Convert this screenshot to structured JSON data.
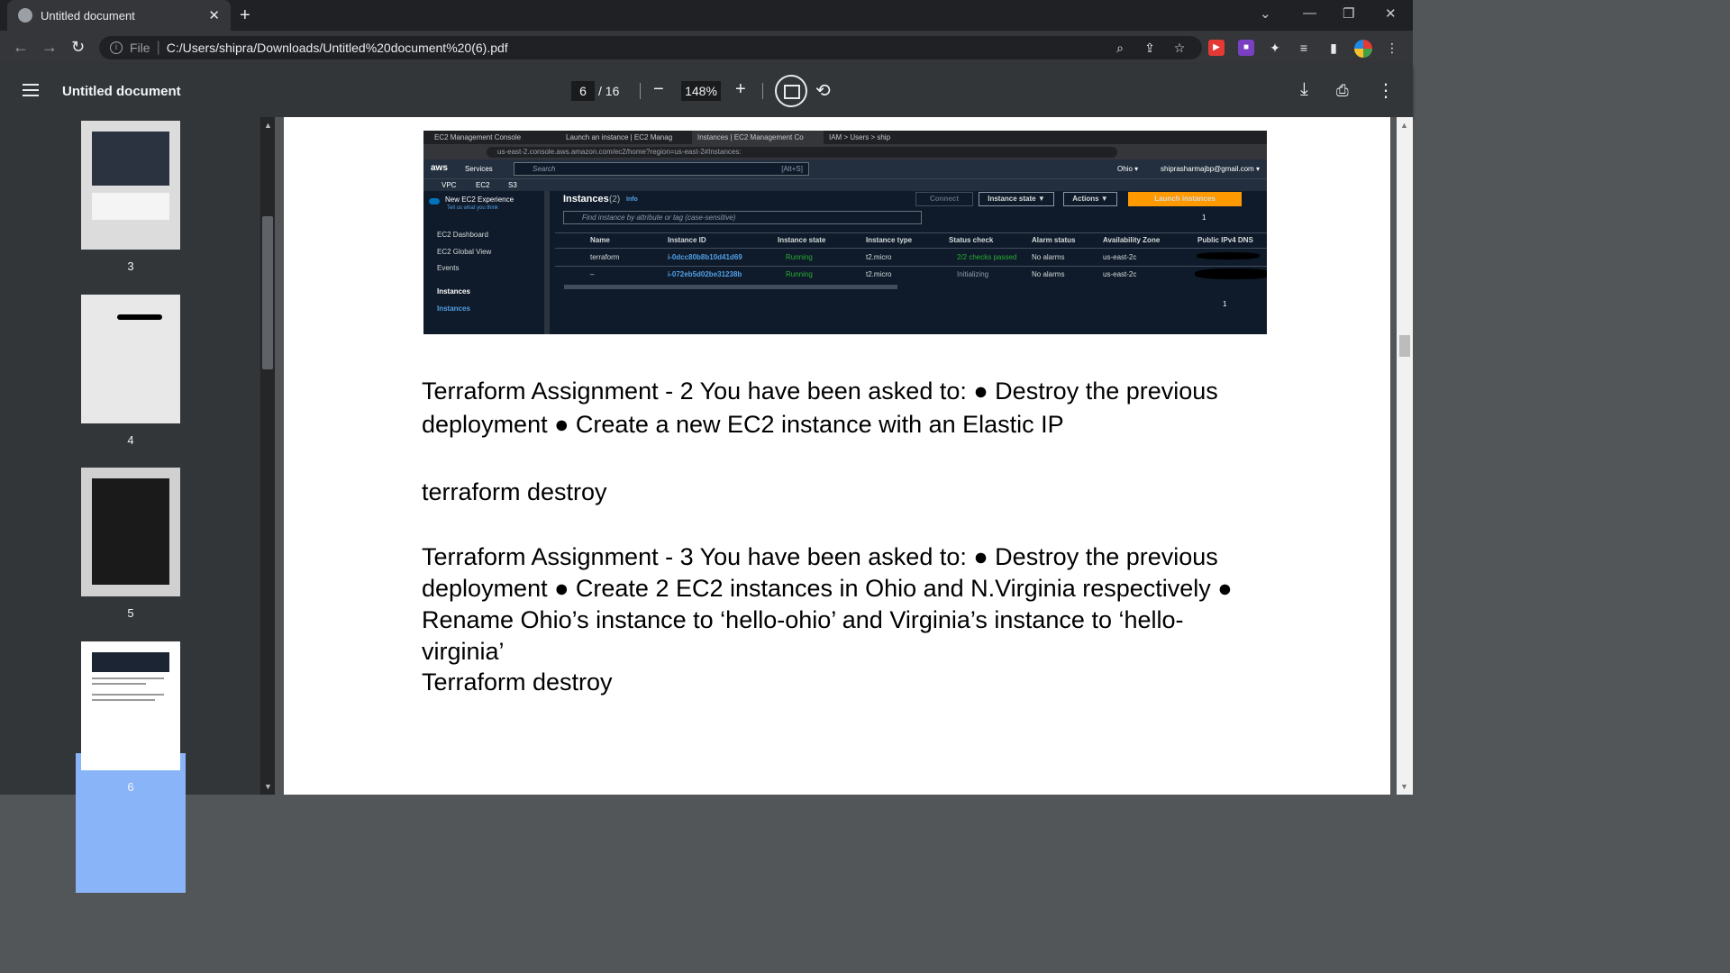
{
  "browser": {
    "tab_title": "Untitled document",
    "address_prefix": "File",
    "address_url": "C:/Users/shipra/Downloads/Untitled%20document%20(6).pdf"
  },
  "pdf_toolbar": {
    "document_title": "Untitled document",
    "current_page": "6",
    "total_pages": "/ 16",
    "zoom": "148%"
  },
  "thumbnails": [
    {
      "page": "3"
    },
    {
      "page": "4"
    },
    {
      "page": "5"
    },
    {
      "page": "6"
    }
  ],
  "embedded_screenshot": {
    "tabs": [
      "EC2 Management Console",
      "Launch an instance | EC2 Manag",
      "Instances | EC2 Management Co",
      "IAM > Users > ship"
    ],
    "url": "us-east-2.console.aws.amazon.com/ec2/home?region=us-east-2#Instances:",
    "aws_logo": "aws",
    "services": "Services",
    "search_placeholder": "Search",
    "search_shortcut": "[Alt+S]",
    "region": "Ohio ▾",
    "account": "shiprasharmajbp@gmail.com ▾",
    "favorites": [
      "VPC",
      "EC2",
      "S3"
    ],
    "new_experience": "New EC2 Experience",
    "new_experience_sub": "Tell us what you think",
    "nav_items": [
      "EC2 Dashboard",
      "EC2 Global View",
      "Events"
    ],
    "nav_section": "Instances",
    "nav_active": "Instances",
    "heading": "Instances",
    "count": "(2)",
    "info": "Info",
    "connect": "Connect",
    "instance_state": "Instance state ▼",
    "actions": "Actions ▼",
    "launch": "Launch instances",
    "filter_placeholder": "Find instance by attribute or tag (case-sensitive)",
    "page_num": "1",
    "columns": [
      "Name",
      "Instance ID",
      "Instance state",
      "Instance type",
      "Status check",
      "Alarm status",
      "Availability Zone",
      "Public IPv4 DNS"
    ],
    "rows": [
      {
        "name": "terraform",
        "id": "i-0dcc80b8b10d41d69",
        "state": "Running",
        "type": "t2.micro",
        "status": "2/2 checks passed",
        "alarm": "No alarms",
        "az": "us-east-2c"
      },
      {
        "name": "–",
        "id": "i-072eb5d02be31238b",
        "state": "Running",
        "type": "t2.micro",
        "status": "Initializing",
        "alarm": "No alarms",
        "az": "us-east-2c"
      }
    ],
    "bottom_page": "1"
  },
  "page_text": {
    "p1": "Terraform Assignment - 2 You have been asked to: ● Destroy the previous deployment ● Create a new EC2 instance with an Elastic IP",
    "p2": "terraform destroy",
    "p3": "Terraform Assignment - 3 You have been asked to: ● Destroy the previous deployment ● Create 2 EC2 instances in Ohio and N.Virginia respectively ● Rename Ohio’s instance to ‘hello-ohio’ and Virginia’s instance to ‘hello-virginia’",
    "p4": "Terraform destroy"
  },
  "colors": {
    "accent": "#8ab4f8",
    "aws_orange": "#ff9900",
    "aws_navy": "#232f3e"
  }
}
